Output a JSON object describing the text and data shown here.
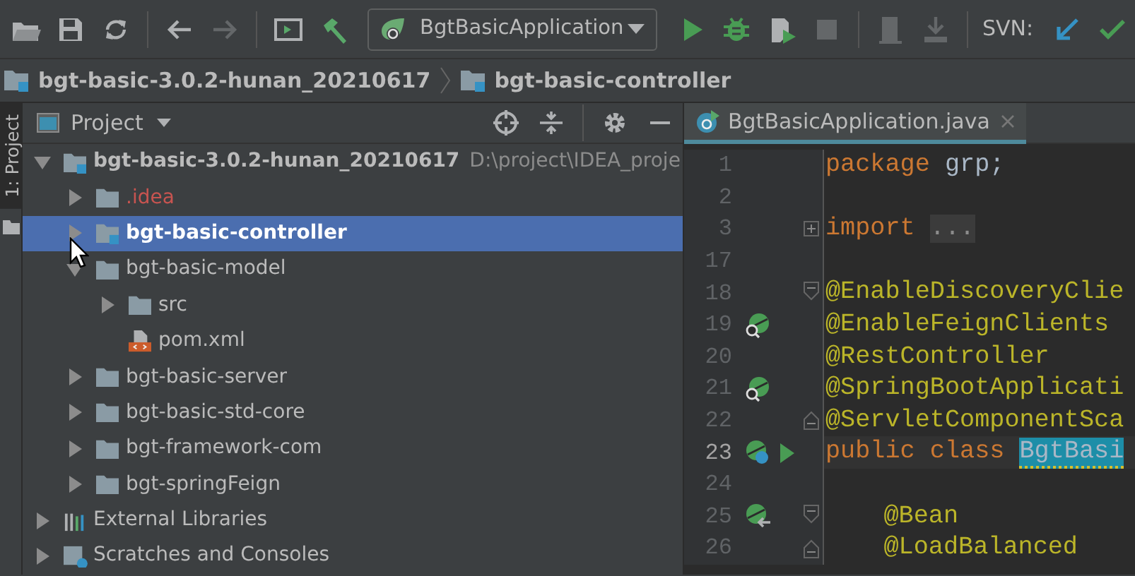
{
  "toolbar": {
    "items": [
      {
        "kind": "open",
        "disabled": false
      },
      {
        "kind": "save",
        "disabled": false
      },
      {
        "kind": "sync",
        "disabled": false
      },
      {
        "kind": "sep"
      },
      {
        "kind": "back",
        "disabled": false
      },
      {
        "kind": "forward",
        "disabled": true
      },
      {
        "kind": "sep"
      },
      {
        "kind": "run-window",
        "disabled": false
      },
      {
        "kind": "build",
        "disabled": false
      },
      {
        "kind": "run-config",
        "label": "BgtBasicApplication"
      },
      {
        "kind": "run",
        "disabled": false
      },
      {
        "kind": "debug",
        "disabled": false
      },
      {
        "kind": "coverage",
        "disabled": false
      },
      {
        "kind": "stop",
        "disabled": true
      },
      {
        "kind": "sep"
      },
      {
        "kind": "history",
        "disabled": true
      },
      {
        "kind": "revert",
        "disabled": true
      },
      {
        "kind": "sep"
      },
      {
        "kind": "label",
        "label": "SVN:"
      },
      {
        "kind": "update",
        "disabled": false
      },
      {
        "kind": "commit",
        "disabled": false
      }
    ]
  },
  "breadcrumb": [
    {
      "label": "bgt-basic-3.0.2-hunan_20210617"
    },
    {
      "label": "bgt-basic-controller"
    }
  ],
  "side_strip": {
    "label": "1: Project"
  },
  "project_panel": {
    "title": "Project",
    "tree": [
      {
        "label": "bgt-basic-3.0.2-hunan_20210617",
        "path": "D:\\project\\IDEA_proje",
        "kind": "project",
        "expanded": true,
        "selected": false,
        "color": "#bbbbbb",
        "children": [
          {
            "label": ".idea",
            "kind": "folder",
            "expanded": false,
            "selected": false,
            "color": "#c75450"
          },
          {
            "label": "bgt-basic-controller",
            "kind": "module",
            "expanded": false,
            "selected": true,
            "color": "#ffffff"
          },
          {
            "label": "bgt-basic-model",
            "kind": "folder",
            "expanded": true,
            "selected": false,
            "color": "#bbbbbb",
            "children": [
              {
                "label": "src",
                "kind": "folder",
                "expanded": false,
                "selected": false,
                "color": "#bbbbbb"
              },
              {
                "label": "pom.xml",
                "kind": "xml",
                "selected": false,
                "color": "#bbbbbb"
              }
            ]
          },
          {
            "label": "bgt-basic-server",
            "kind": "folder",
            "expanded": false,
            "selected": false,
            "color": "#bbbbbb"
          },
          {
            "label": "bgt-basic-std-core",
            "kind": "folder",
            "expanded": false,
            "selected": false,
            "color": "#bbbbbb"
          },
          {
            "label": "bgt-framework-com",
            "kind": "folder",
            "expanded": false,
            "selected": false,
            "color": "#bbbbbb"
          },
          {
            "label": "bgt-springFeign",
            "kind": "folder",
            "expanded": false,
            "selected": false,
            "color": "#bbbbbb"
          }
        ]
      },
      {
        "label": "External Libraries",
        "kind": "libraries",
        "expanded": false,
        "selected": false,
        "color": "#bbbbbb"
      },
      {
        "label": "Scratches and Consoles",
        "kind": "scratches",
        "expanded": false,
        "selected": false,
        "color": "#bbbbbb"
      }
    ]
  },
  "editor": {
    "tab": {
      "label": "BgtBasicApplication.java",
      "selected": true
    },
    "lines": [
      {
        "number": "1",
        "current": false,
        "tokens": [
          {
            "kind": "keyword",
            "text": "package"
          },
          {
            "kind": "plain",
            "text": " grp;"
          }
        ]
      },
      {
        "number": "2",
        "current": false
      },
      {
        "number": "3",
        "current": false,
        "fold": {
          "kind": "collapsed"
        },
        "tokens": [
          {
            "kind": "keyword",
            "text": "import"
          },
          {
            "kind": "folded",
            "text": "..."
          }
        ]
      },
      {
        "number": "17",
        "current": false
      },
      {
        "number": "18",
        "current": false,
        "fold": {
          "kind": "open"
        },
        "tokens": [
          {
            "kind": "annotation",
            "text": "@EnableDiscoveryClie"
          }
        ]
      },
      {
        "number": "19",
        "current": false,
        "gutter": {
          "kind": "bean-search"
        },
        "tokens": [
          {
            "kind": "annotation",
            "text": "@EnableFeignClients"
          }
        ]
      },
      {
        "number": "20",
        "current": false,
        "tokens": [
          {
            "kind": "annotation",
            "text": "@RestController"
          }
        ]
      },
      {
        "number": "21",
        "current": false,
        "gutter": {
          "kind": "bean-search"
        },
        "tokens": [
          {
            "kind": "annotation",
            "text": "@SpringBootApplicati"
          }
        ]
      },
      {
        "number": "22",
        "current": false,
        "fold": {
          "kind": "end"
        },
        "tokens": [
          {
            "kind": "annotation",
            "text": "@ServletComponentSca"
          }
        ]
      },
      {
        "number": "23",
        "current": true,
        "gutter": {
          "kind": "bean-class"
        },
        "run": true,
        "tokens": [
          {
            "kind": "keyword",
            "text": "public class"
          },
          {
            "kind": "highlight",
            "text": "BgtBasi"
          }
        ]
      },
      {
        "number": "24",
        "current": false
      },
      {
        "number": "25",
        "current": false,
        "gutter": {
          "kind": "bean-inject"
        },
        "fold": {
          "kind": "open"
        },
        "indented": true,
        "tokens": [
          {
            "kind": "annotation",
            "text": "@Bean"
          }
        ]
      },
      {
        "number": "26",
        "current": false,
        "fold": {
          "kind": "end"
        },
        "indented": true,
        "tokens": [
          {
            "kind": "annotation",
            "text": "@LoadBalanced"
          }
        ]
      }
    ]
  }
}
